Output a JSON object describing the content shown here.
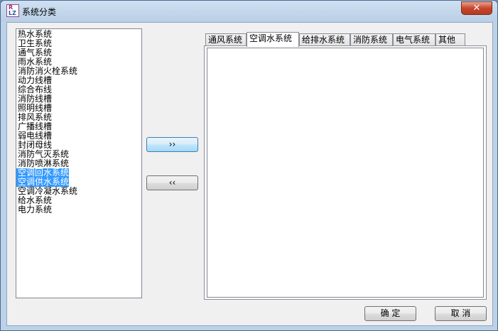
{
  "window": {
    "title": "系统分类",
    "icon": "rlz-app-icon",
    "close_label": "✕"
  },
  "system_list": {
    "items": [
      {
        "label": "热水系统",
        "selected": false
      },
      {
        "label": "卫生系统",
        "selected": false
      },
      {
        "label": "通气系统",
        "selected": false
      },
      {
        "label": "雨水系统",
        "selected": false
      },
      {
        "label": "消防消火栓系统",
        "selected": false
      },
      {
        "label": "动力线槽",
        "selected": false
      },
      {
        "label": "综合布线",
        "selected": false
      },
      {
        "label": "消防线槽",
        "selected": false
      },
      {
        "label": "照明线槽",
        "selected": false
      },
      {
        "label": "排风系统",
        "selected": false
      },
      {
        "label": "广播线槽",
        "selected": false
      },
      {
        "label": "弱电线槽",
        "selected": false
      },
      {
        "label": "封闭母线",
        "selected": false
      },
      {
        "label": "消防气灭系统",
        "selected": false
      },
      {
        "label": "消防喷淋系统",
        "selected": false
      },
      {
        "label": "空调回水系统",
        "selected": true
      },
      {
        "label": "空调供水系统",
        "selected": true
      },
      {
        "label": "空调冷凝水系统",
        "selected": false
      },
      {
        "label": "给水系统",
        "selected": false
      },
      {
        "label": "电力系统",
        "selected": false
      }
    ]
  },
  "buttons": {
    "move_right": "››",
    "move_left": "‹‹",
    "ok": "确 定",
    "cancel": "取 消"
  },
  "tabs": [
    {
      "label": "通风系统",
      "active": false
    },
    {
      "label": "空调水系统",
      "active": true
    },
    {
      "label": "给排水系统",
      "active": false
    },
    {
      "label": "消防系统",
      "active": false
    },
    {
      "label": "电气系统",
      "active": false
    },
    {
      "label": "其他",
      "active": false
    }
  ],
  "colors": {
    "selection": "#3399ff",
    "close_button": "#c7462b"
  }
}
